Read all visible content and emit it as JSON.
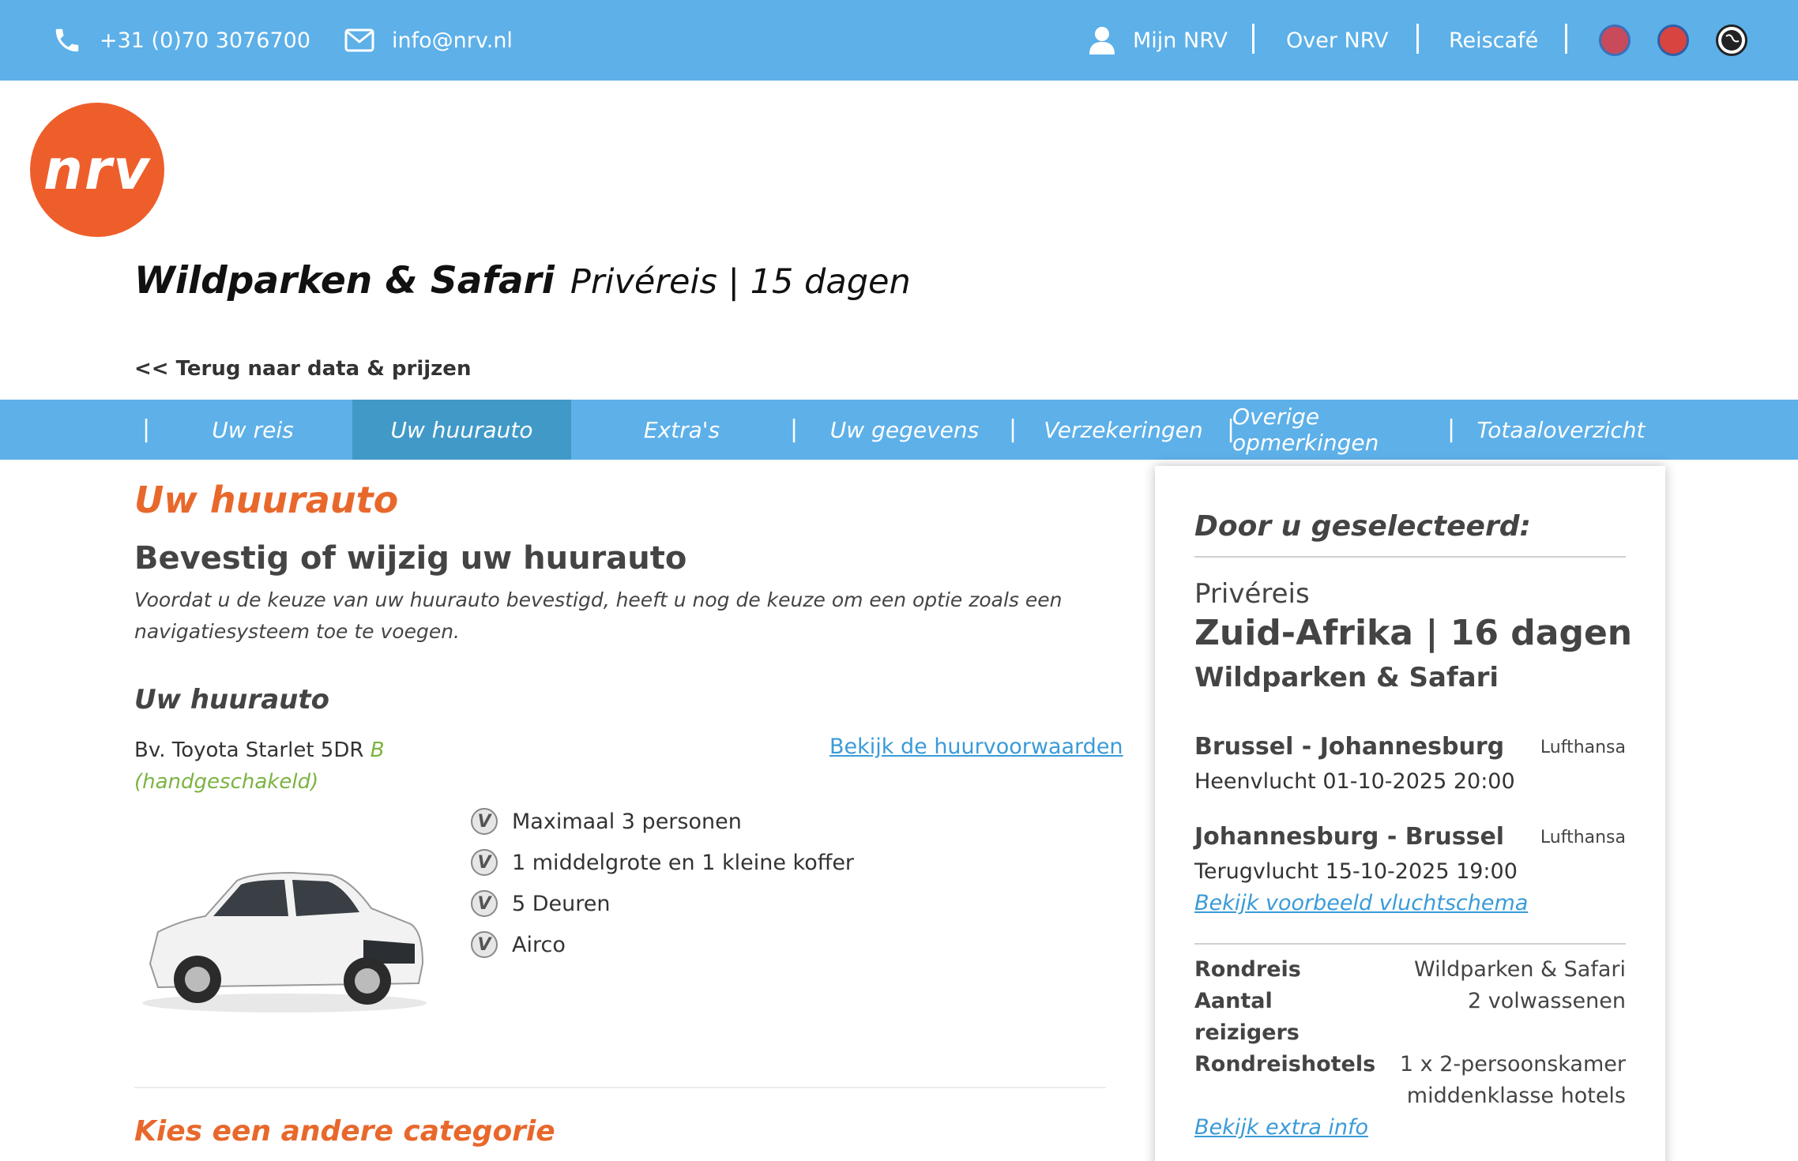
{
  "topbar": {
    "phone": "+31 (0)70 3076700",
    "email": "info@nrv.nl",
    "links": [
      "Mijn NRV",
      "Over NRV",
      "Reiscafé"
    ],
    "badges": [
      "anvr-badge",
      "sgr-badge",
      "globe-badge"
    ]
  },
  "logo": {
    "text": "nrv",
    "color": "#ee5e2b"
  },
  "trip": {
    "title": "Wildparken & Safari",
    "subtitle": "Privéreis | 15 dagen",
    "back_link": "<< Terug naar data & prijzen"
  },
  "steps": {
    "tabs": [
      "Uw reis",
      "Uw huurauto",
      "Extra's",
      "Uw gegevens",
      "Verzekeringen",
      "Overige opmerkingen",
      "Totaaloverzicht"
    ],
    "active_index": 1
  },
  "main": {
    "section_title": "Uw huurauto",
    "heading": "Bevestig of wijzig uw huurauto",
    "intro": "Voordat u de keuze van uw huurauto bevestigd, heeft u nog de keuze om een optie zoals een navigatiesysteem toe te voegen.",
    "car_heading": "Uw huurauto",
    "car_name": "Bv. Toyota Starlet 5DR",
    "car_class": "B",
    "car_transmission": "(handgeschakeld)",
    "terms_link": "Bekijk de huurvoorwaarden",
    "features": [
      "Maximaal 3 personen",
      "1 middelgrote en 1 kleine koffer",
      "5 Deuren",
      "Airco"
    ],
    "other_category": "Kies een andere categorie"
  },
  "sidebar": {
    "title": "Door u geselecteerd:",
    "trip_type": "Privéreis",
    "destination": "Zuid-Afrika | 16 dagen",
    "trip_name": "Wildparken & Safari",
    "outbound": {
      "route": "Brussel - Johannesburg",
      "airline": "Lufthansa",
      "details": "Heenvlucht 01-10-2025  20:00"
    },
    "inbound": {
      "route": "Johannesburg - Brussel",
      "airline": "Lufthansa",
      "details": "Terugvlucht 15-10-2025  19:00"
    },
    "schedule_link": "Bekijk voorbeeld vluchtschema",
    "rondreis_label": "Rondreis",
    "rondreis_value": "Wildparken & Safari",
    "travelers_label_1": "Aantal",
    "travelers_label_2": "reizigers",
    "travelers_value": "2 volwassenen",
    "hotels_label": "Rondreishotels",
    "hotels_value_1": "1 x 2-persoonskamer",
    "hotels_value_2": "middenklasse hotels",
    "extra_info_link": "Bekijk extra info"
  },
  "colors": {
    "header_blue": "#5db0e8",
    "active_tab": "#4199c8",
    "accent_orange": "#e8682c",
    "link_blue": "#3a9bd8",
    "class_green": "#7cb342"
  }
}
